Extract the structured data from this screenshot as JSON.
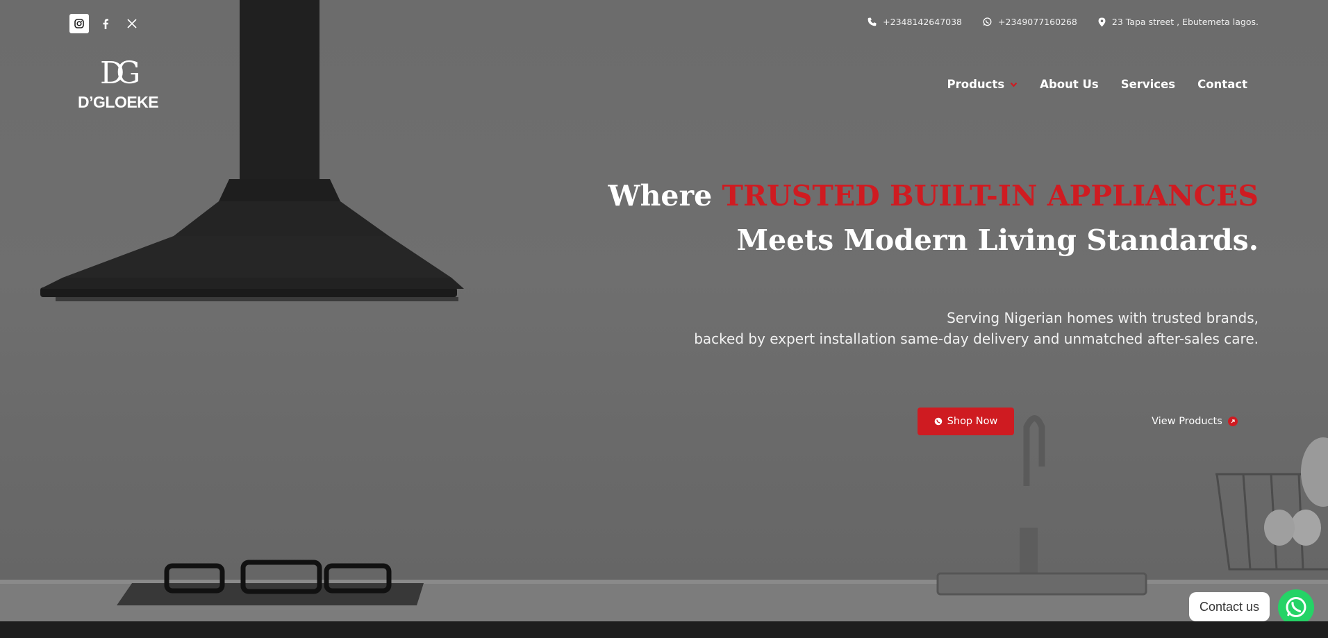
{
  "social": {
    "instagram_icon": "instagram-icon",
    "facebook_icon": "facebook-icon",
    "x_icon": "x-icon"
  },
  "contact_bar": {
    "phone": "+2348142647038",
    "whatsapp": "+2349077160268",
    "address": "23 Tapa street , Ebutemeta lagos."
  },
  "logo": {
    "monogram": "DG",
    "wordmark": "D’GLOEKE"
  },
  "nav": {
    "products": "Products",
    "about": "About Us",
    "services": "Services",
    "contact": "Contact"
  },
  "hero": {
    "headline_prefix": "Where ",
    "headline_accent": "TRUSTED BUILT-IN APPLIANCES",
    "headline_line2": "Meets Modern Living Standards.",
    "subtitle_line1": "Serving Nigerian homes with trusted brands,",
    "subtitle_line2": "backed by expert installation same-day delivery and unmatched after-sales care.",
    "shop_now": "Shop Now",
    "view_products": "View Products"
  },
  "chat": {
    "contact_us": "Contact us"
  },
  "colors": {
    "accent": "#cf1b21",
    "whatsapp": "#25d366"
  }
}
